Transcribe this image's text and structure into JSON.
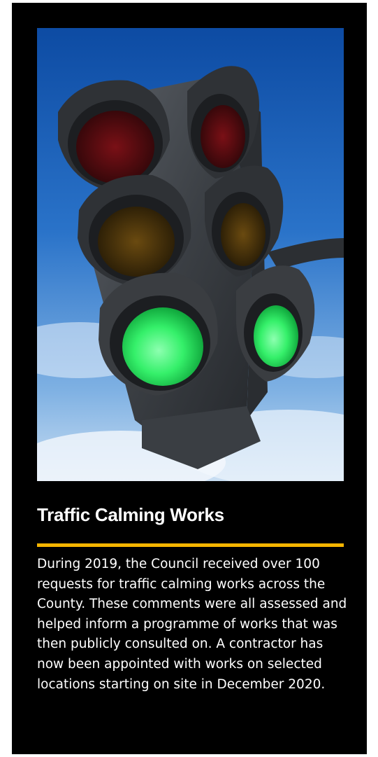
{
  "article": {
    "title": "Traffic Calming Works",
    "body": "During 2019, the Council received over 100 requests for traffic calming works across the County. These comments were all assessed and helped inform a programme of works that was then publicly consulted on.  A contractor has now been appointed with works on selected locations starting on site in December 2020."
  },
  "image": {
    "subject": "traffic-light-green",
    "colors": {
      "sky": "#2a73c9",
      "housing": "#3c4045",
      "red": "#c0141e",
      "amber": "#b07a16",
      "green": "#35f06a"
    }
  },
  "colors": {
    "background": "#000000",
    "accent": "#f5b400",
    "text": "#ffffff"
  }
}
